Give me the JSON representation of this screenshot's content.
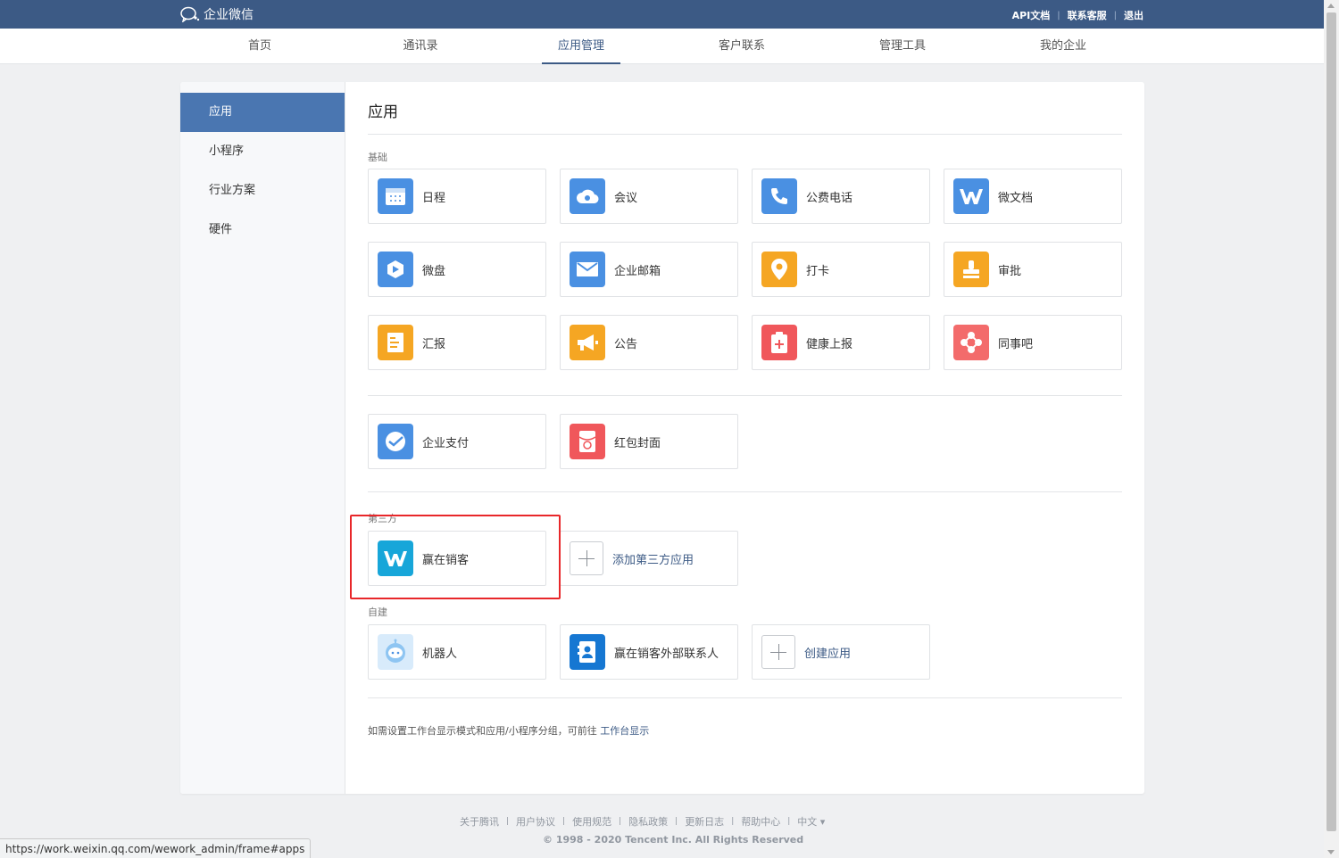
{
  "header": {
    "logo_text": "企业微信",
    "links": [
      "API文档",
      "联系客服",
      "退出"
    ]
  },
  "nav": {
    "items": [
      "首页",
      "通讯录",
      "应用管理",
      "客户联系",
      "管理工具",
      "我的企业"
    ],
    "active": "应用管理"
  },
  "sidebar": {
    "items": [
      "应用",
      "小程序",
      "行业方案",
      "硬件"
    ],
    "active": "应用"
  },
  "main": {
    "title": "应用",
    "basic_label": "基础",
    "basic_apps": [
      {
        "label": "日程",
        "icon": "calendar-icon",
        "color": "#4a90e2"
      },
      {
        "label": "会议",
        "icon": "cloud-icon",
        "color": "#4a90e2"
      },
      {
        "label": "公费电话",
        "icon": "phone-icon",
        "color": "#4a90e2"
      },
      {
        "label": "微文档",
        "icon": "w-doc-icon",
        "color": "#4a90e2"
      },
      {
        "label": "微盘",
        "icon": "drive-icon",
        "color": "#4a90e2"
      },
      {
        "label": "企业邮箱",
        "icon": "mail-icon",
        "color": "#4a90e2"
      },
      {
        "label": "打卡",
        "icon": "location-pin-icon",
        "color": "#f5a623"
      },
      {
        "label": "审批",
        "icon": "stamp-icon",
        "color": "#f5a623"
      },
      {
        "label": "汇报",
        "icon": "report-icon",
        "color": "#f5a623"
      },
      {
        "label": "公告",
        "icon": "megaphone-icon",
        "color": "#f5a623"
      },
      {
        "label": "健康上报",
        "icon": "health-clipboard-icon",
        "color": "#f0575b"
      },
      {
        "label": "同事吧",
        "icon": "colleague-network-icon",
        "color": "#f36b6b"
      },
      {
        "label": "企业支付",
        "icon": "pay-icon",
        "color": "#4a90e2"
      },
      {
        "label": "红包封面",
        "icon": "red-envelope-icon",
        "color": "#f0575b"
      }
    ],
    "third_party_label": "第三方",
    "third_party_apps": [
      {
        "label": "赢在销客",
        "icon": "w-logo-icon",
        "color": "#17a6d9"
      }
    ],
    "add_third_party_label": "添加第三方应用",
    "custom_label": "自建",
    "custom_apps": [
      {
        "label": "机器人",
        "icon": "robot-icon",
        "color": "#8ec5f2"
      },
      {
        "label": "赢在销客外部联系人",
        "icon": "contact-card-icon",
        "color": "#1677d2"
      }
    ],
    "create_app_label": "创建应用",
    "footnote_text": "如需设置工作台显示模式和应用/小程序分组，可前往",
    "footnote_link": "工作台显示"
  },
  "footer": {
    "links": [
      "关于腾讯",
      "用户协议",
      "使用规范",
      "隐私政策",
      "更新日志",
      "帮助中心",
      "中文 ▾"
    ],
    "copyright": "© 1998 - 2020 Tencent Inc. All Rights Reserved"
  },
  "status_url": "https://work.weixin.qq.com/wework_admin/frame#apps"
}
